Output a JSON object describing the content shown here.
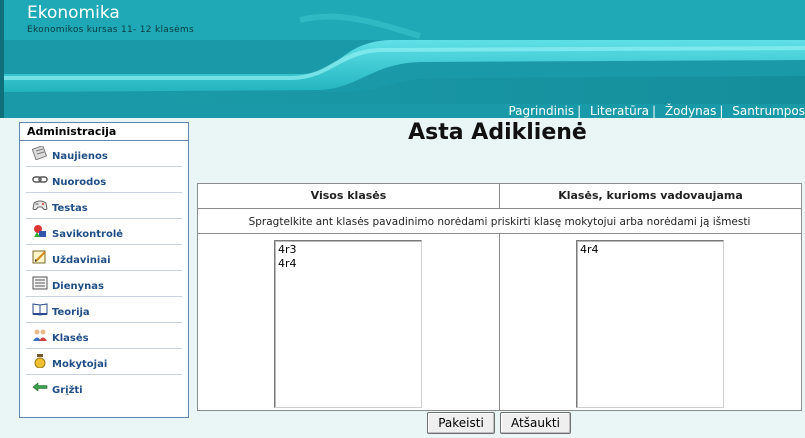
{
  "header": {
    "site_title": "Ekonomika",
    "site_subtitle": "Ekonomikos kursas 11- 12 klasėms",
    "nav": [
      "Pagrindinis",
      "Literatūra",
      "Žodynas",
      "Santrumpos"
    ],
    "nav_separator": "|"
  },
  "sidebar": {
    "title": "Administracija",
    "items": [
      {
        "label": "Naujienos",
        "icon": "newspaper-icon"
      },
      {
        "label": "Nuorodos",
        "icon": "chain-link-icon"
      },
      {
        "label": "Testas",
        "icon": "gamepad-icon"
      },
      {
        "label": "Savikontrolė",
        "icon": "shapes-icon"
      },
      {
        "label": "Uždaviniai",
        "icon": "task-pencil-icon"
      },
      {
        "label": "Dienynas",
        "icon": "journal-icon"
      },
      {
        "label": "Teorija",
        "icon": "book-icon"
      },
      {
        "label": "Klasės",
        "icon": "users-group-icon"
      },
      {
        "label": "Mokytojai",
        "icon": "teacher-icon"
      },
      {
        "label": "Grįžti",
        "icon": "arrow-back-icon"
      }
    ]
  },
  "main": {
    "title": "Asta Adiklienė",
    "columns": [
      "Visos klasės",
      "Klasės, kurioms vadovaujama"
    ],
    "instruction": "Spragtelkite ant klasės pavadinimo norėdami priskirti klasę mokytojui arba norėdami ją išmesti",
    "all_classes": [
      "4r3",
      "4r4"
    ],
    "managed_classes": [
      "4r4"
    ],
    "buttons": {
      "save": "Pakeisti",
      "cancel": "Atšaukti"
    }
  },
  "colors": {
    "header_teal": "#1ea6b3",
    "menu_link": "#1f4e86",
    "content_bg": "#eaf5f5",
    "sidebar_border": "#5e86b0"
  }
}
